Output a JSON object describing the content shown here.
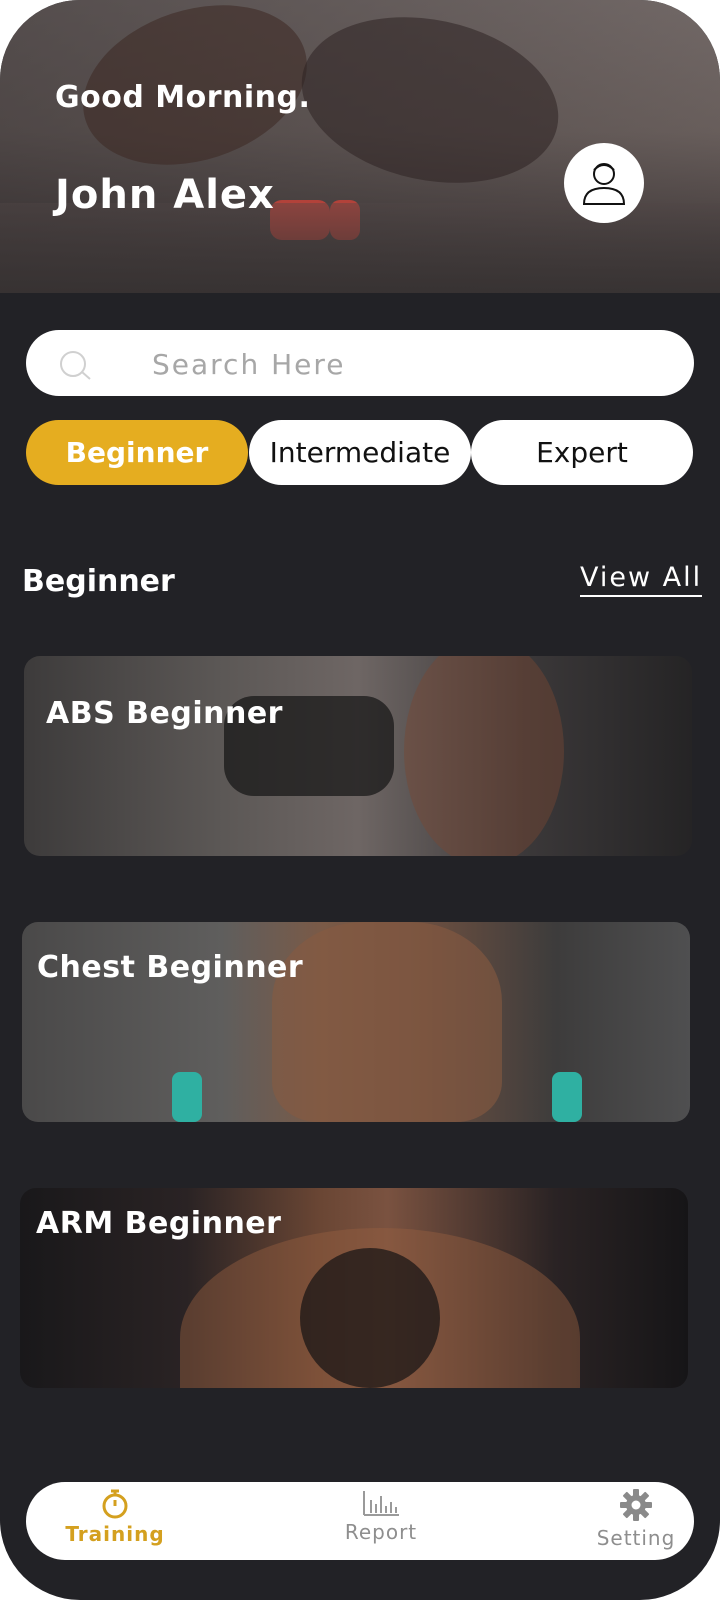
{
  "header": {
    "greeting": "Good Morning.",
    "username": "John Alex",
    "avatar_icon": "user-icon"
  },
  "search": {
    "placeholder": "Search Here",
    "value": "",
    "icon": "search-icon"
  },
  "levels": {
    "tabs": [
      {
        "label": "Beginner",
        "active": true
      },
      {
        "label": "Intermediate",
        "active": false
      },
      {
        "label": "Expert",
        "active": false
      }
    ]
  },
  "section": {
    "title": "Beginner",
    "view_all": "View All"
  },
  "workouts": [
    {
      "label": "ABS Beginner"
    },
    {
      "label": "Chest Beginner"
    },
    {
      "label": "ARM Beginner"
    }
  ],
  "bottom_nav": {
    "items": [
      {
        "label": "Training",
        "icon": "stopwatch-icon",
        "active": true
      },
      {
        "label": "Report",
        "icon": "bar-chart-icon",
        "active": false
      },
      {
        "label": "Setting",
        "icon": "gear-icon",
        "active": false
      }
    ]
  },
  "colors": {
    "background": "#222226",
    "accent": "#e5ad20",
    "surface": "#ffffff"
  }
}
